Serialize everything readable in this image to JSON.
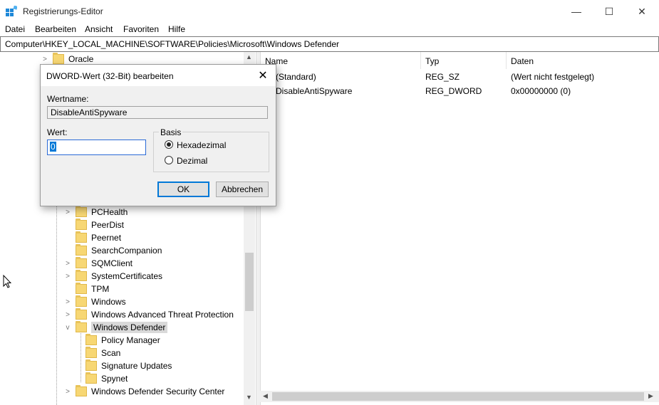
{
  "window": {
    "title": "Registrierungs-Editor",
    "controls": {
      "minimize": "—",
      "maximize": "☐",
      "close": "✕"
    }
  },
  "menu": [
    "Datei",
    "Bearbeiten",
    "Ansicht",
    "Favoriten",
    "Hilfe"
  ],
  "address": "Computer\\HKEY_LOCAL_MACHINE\\SOFTWARE\\Policies\\Microsoft\\Windows Defender",
  "tree": {
    "top_item": "Oracle",
    "items": [
      {
        "label": "PCHealth",
        "expander": ">"
      },
      {
        "label": "PeerDist",
        "expander": ""
      },
      {
        "label": "Peernet",
        "expander": ""
      },
      {
        "label": "SearchCompanion",
        "expander": ""
      },
      {
        "label": "SQMClient",
        "expander": ">"
      },
      {
        "label": "SystemCertificates",
        "expander": ">"
      },
      {
        "label": "TPM",
        "expander": ""
      },
      {
        "label": "Windows",
        "expander": ">"
      },
      {
        "label": "Windows Advanced Threat Protection",
        "expander": ">"
      },
      {
        "label": "Windows Defender",
        "expander": "v",
        "selected": true
      },
      {
        "label": "Policy Manager",
        "child": true
      },
      {
        "label": "Scan",
        "child": true
      },
      {
        "label": "Signature Updates",
        "child": true
      },
      {
        "label": "Spynet",
        "child": true
      },
      {
        "label": "Windows Defender Security Center",
        "expander": ">"
      }
    ]
  },
  "list": {
    "columns": [
      "Name",
      "Typ",
      "Daten"
    ],
    "rows": [
      {
        "name": "(Standard)",
        "type": "REG_SZ",
        "data": "(Wert nicht festgelegt)"
      },
      {
        "name": "DisableAntiSpyware",
        "type": "REG_DWORD",
        "data": "0x00000000 (0)"
      }
    ]
  },
  "dialog": {
    "title": "DWORD-Wert (32-Bit) bearbeiten",
    "value_name_label": "Wertname:",
    "value_name": "DisableAntiSpyware",
    "value_label": "Wert:",
    "value": "0",
    "basis_label": "Basis",
    "radio_hex": "Hexadezimal",
    "radio_dec": "Dezimal",
    "selected_basis": "Hexadezimal",
    "ok": "OK",
    "cancel": "Abbrechen"
  },
  "colors": {
    "selection": "#d9d9d9",
    "folder": "#f7d774",
    "accent": "#0078d7"
  }
}
